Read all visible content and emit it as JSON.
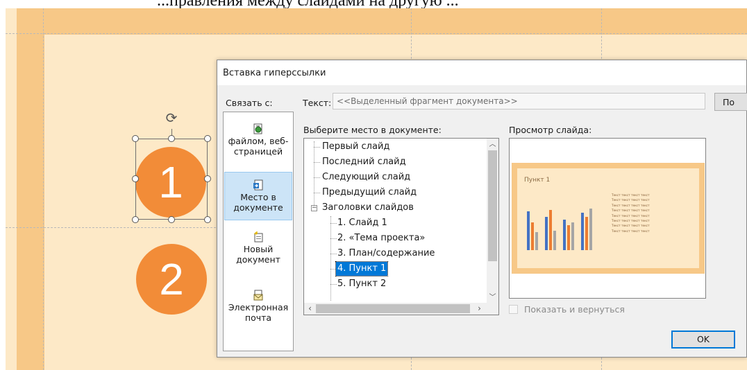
{
  "document": {
    "top_text": "...правления между слайдами на другую ..."
  },
  "slide": {
    "circle1": "1",
    "circle2": "2"
  },
  "dialog": {
    "title": "Вставка гиперссылки",
    "link_with_label": "Связать с:",
    "text_label": "Текст:",
    "text_value": "<<Выделенный фрагмент документа>>",
    "screen_tip_button": "По",
    "link_options": [
      {
        "label": "файлом, веб-страницей",
        "icon": "web-file-icon"
      },
      {
        "label": "Место в документе",
        "icon": "place-in-document-icon"
      },
      {
        "label": "Новый документ",
        "icon": "new-document-icon"
      },
      {
        "label": "Электронная почта",
        "icon": "email-icon"
      }
    ],
    "place_label": "Выберите место в документе:",
    "tree": {
      "items": [
        "Первый слайд",
        "Последний слайд",
        "Следующий слайд",
        "Предыдущий слайд",
        "Заголовки слайдов",
        "1. Слайд 1",
        "2. «Тема проекта»",
        "3. План/содержание",
        "4. Пункт 1",
        "5. Пункт 2"
      ],
      "selected_item": "4. Пункт 1"
    },
    "preview_label": "Просмотр слайда:",
    "preview": {
      "slide_title": "Пункт 1",
      "text_lines": [
        "Текст текст текст текст",
        "Текст текст текст текст",
        "Текст текст текст текст",
        "Текст текст текст текст",
        "Текст текст текст текст",
        "Текст текст текст текст",
        "Текст текст текст текст",
        "Текст текст текст текст"
      ],
      "bar_colors": [
        "#4472c4",
        "#ed7d31",
        "#a5a5a5"
      ]
    },
    "show_and_return_label": "Показать и вернуться",
    "show_and_return_checked": false,
    "ok_button": "OK"
  }
}
